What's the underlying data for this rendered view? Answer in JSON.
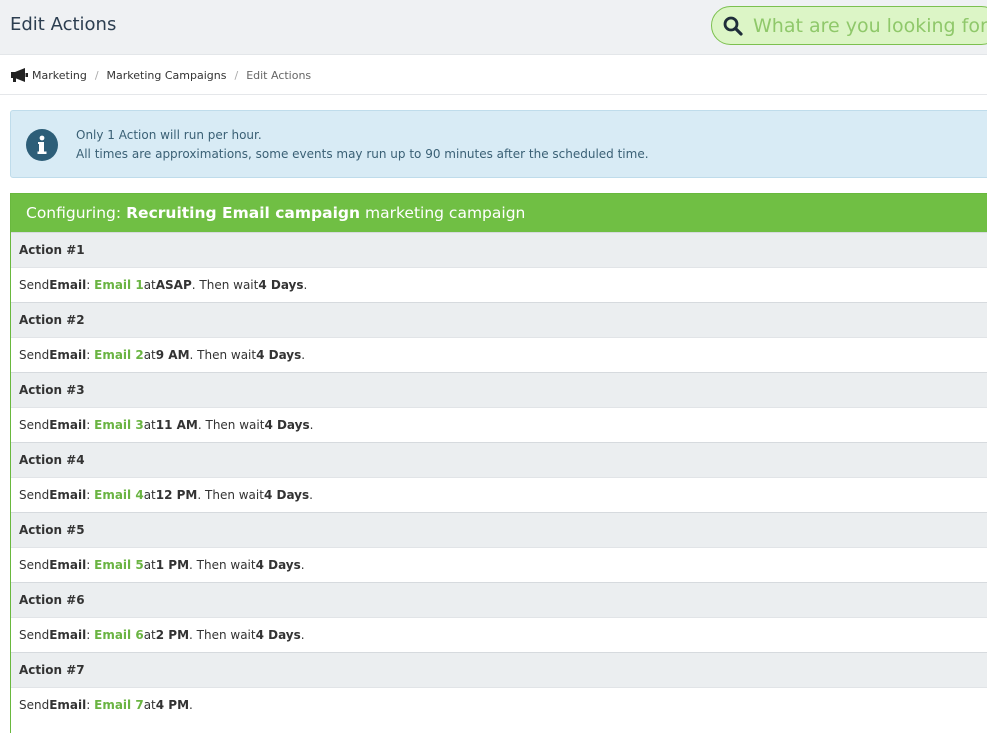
{
  "header": {
    "title": "Edit Actions",
    "search_placeholder": "What are you looking for?"
  },
  "breadcrumb": {
    "icon": "megaphone-icon",
    "items": [
      "Marketing",
      "Marketing Campaigns",
      "Edit Actions"
    ],
    "separator": "/"
  },
  "info": {
    "icon": "info-icon",
    "line1": "Only 1 Action will run per hour.",
    "line2": "All times are approximations, some events may run up to 90 minutes after the scheduled time."
  },
  "panel": {
    "prefix": "Configuring:",
    "campaign_name": "Recruiting Email campaign",
    "suffix": "marketing campaign"
  },
  "actions": [
    {
      "title": "Action #1",
      "send": "Send",
      "type": "Email",
      "email": "Email 1",
      "at": "at",
      "time": "ASAP",
      "wait_text": ". Then wait",
      "wait": "4 Days",
      "end": "."
    },
    {
      "title": "Action #2",
      "send": "Send",
      "type": "Email",
      "email": "Email 2",
      "at": "at",
      "time": "9 AM",
      "wait_text": ". Then wait",
      "wait": "4 Days",
      "end": "."
    },
    {
      "title": "Action #3",
      "send": "Send",
      "type": "Email",
      "email": "Email 3",
      "at": "at",
      "time": "11 AM",
      "wait_text": ". Then wait",
      "wait": "4 Days",
      "end": "."
    },
    {
      "title": "Action #4",
      "send": "Send",
      "type": "Email",
      "email": "Email 4",
      "at": "at",
      "time": "12 PM",
      "wait_text": ". Then wait",
      "wait": "4 Days",
      "end": "."
    },
    {
      "title": "Action #5",
      "send": "Send",
      "type": "Email",
      "email": "Email 5",
      "at": "at",
      "time": "1 PM",
      "wait_text": ". Then wait",
      "wait": "4 Days",
      "end": "."
    },
    {
      "title": "Action #6",
      "send": "Send",
      "type": "Email",
      "email": "Email 6",
      "at": "at",
      "time": "2 PM",
      "wait_text": ". Then wait",
      "wait": "4 Days",
      "end": "."
    },
    {
      "title": "Action #7",
      "send": "Send",
      "type": "Email",
      "email": "Email 7",
      "at": "at",
      "time": "4 PM",
      "wait_text": "",
      "wait": "",
      "end": "."
    }
  ],
  "colors": {
    "accent_green": "#70bf44",
    "link_green": "#6ab442",
    "info_bg": "#d8ebf5",
    "info_icon": "#2d5e78"
  }
}
